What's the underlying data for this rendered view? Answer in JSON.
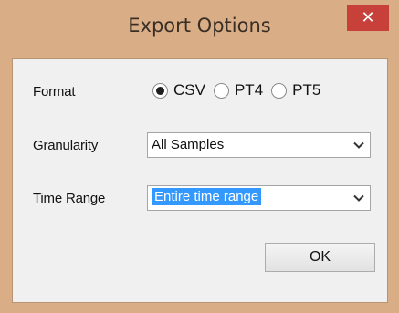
{
  "window": {
    "title": "Export Options",
    "close_glyph": "✕",
    "colors": {
      "titlebar": "#d9ae87",
      "close_button": "#c7403a",
      "selection": "#3399ff"
    }
  },
  "form": {
    "format": {
      "label": "Format",
      "options": [
        {
          "label": "CSV",
          "checked": true
        },
        {
          "label": "PT4",
          "checked": false
        },
        {
          "label": "PT5",
          "checked": false
        }
      ]
    },
    "granularity": {
      "label": "Granularity",
      "value": "All Samples"
    },
    "time_range": {
      "label": "Time Range",
      "value": "Entire time range"
    }
  },
  "buttons": {
    "ok_label": "OK"
  },
  "icons": {
    "close": "close-icon",
    "dropdown": "chevron-down-icon"
  }
}
